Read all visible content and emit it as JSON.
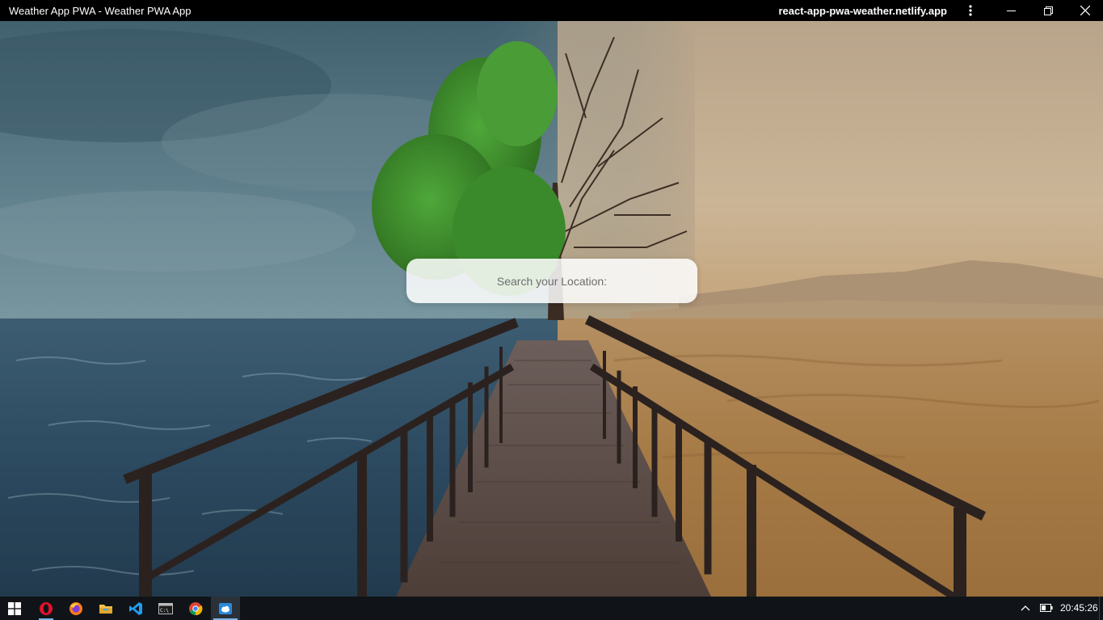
{
  "window": {
    "title": "Weather App PWA - Weather PWA App",
    "url": "react-app-pwa-weather.netlify.app",
    "menu_icon": "kebab-menu-icon",
    "minimize_icon": "minimize-icon",
    "maximize_icon": "restore-icon",
    "close_icon": "close-icon"
  },
  "search": {
    "placeholder": "Search your Location:",
    "value": ""
  },
  "taskbar": {
    "apps": [
      {
        "name": "windows-start",
        "icon": "windows-logo-icon"
      },
      {
        "name": "opera",
        "icon": "opera-icon"
      },
      {
        "name": "firefox",
        "icon": "firefox-icon"
      },
      {
        "name": "file-explorer",
        "icon": "folder-icon"
      },
      {
        "name": "vscode",
        "icon": "vscode-icon"
      },
      {
        "name": "terminal",
        "icon": "terminal-icon"
      },
      {
        "name": "chrome",
        "icon": "chrome-icon"
      },
      {
        "name": "weather-pwa",
        "icon": "weather-cloud-icon"
      }
    ],
    "clock": "20:45:26"
  },
  "colors": {
    "sky_storm": "#5e7f8e",
    "sea": "#2d4d63",
    "desert_sky": "#c9b294",
    "sand": "#b38a57",
    "boardwalk": "#5a4a45",
    "tree_green": "#3c8a2a"
  }
}
